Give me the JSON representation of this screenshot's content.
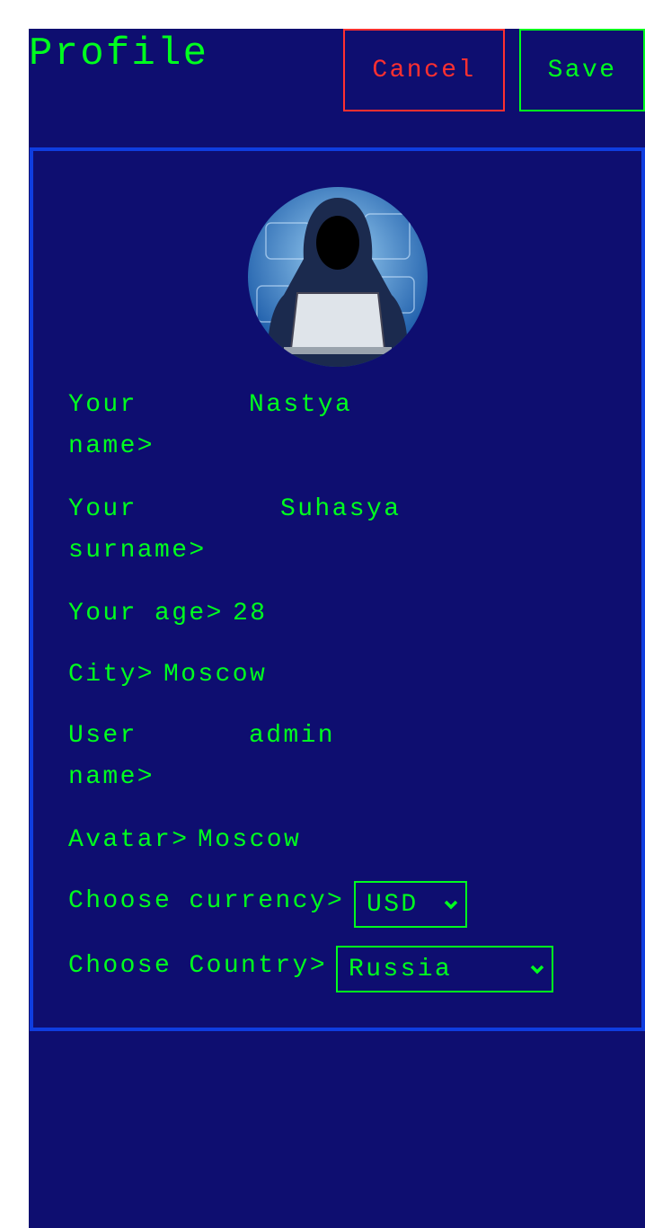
{
  "header": {
    "title": "Profile",
    "cancel_label": "Cancel",
    "save_label": "Save"
  },
  "profile": {
    "name_label": "Your\nname>",
    "name_value": "Nastya",
    "surname_label": "Your\nsurname>",
    "surname_value": "Suhasya",
    "age_label": "Your age>",
    "age_value": "28",
    "city_label": "City>",
    "city_value": "Moscow",
    "username_label": "User\nname>",
    "username_value": "admin",
    "avatar_label": "Avatar>",
    "avatar_value": "Moscow",
    "currency_label": "Choose currency>",
    "currency_value": "USD",
    "country_label": "Choose Country>",
    "country_value": "Russia"
  },
  "colors": {
    "background": "#0e0e70",
    "text": "#00ff1e",
    "cancel": "#ff3030",
    "card_border": "#0f3de0"
  }
}
